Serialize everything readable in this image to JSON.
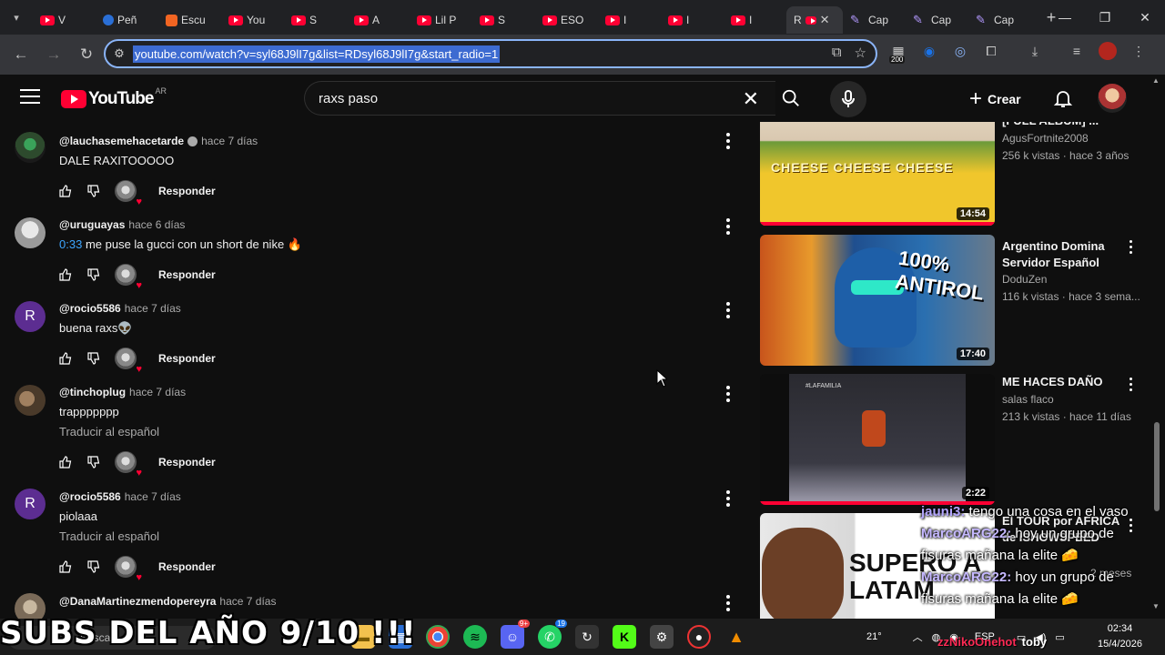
{
  "browser": {
    "tabs": [
      {
        "label": "V",
        "icon": "youtube-icon"
      },
      {
        "label": "Peñ",
        "icon": "gemini-icon"
      },
      {
        "label": "Escu",
        "icon": "soundcloud-icon"
      },
      {
        "label": "You",
        "icon": "youtube-icon"
      },
      {
        "label": "S",
        "icon": "youtube-icon"
      },
      {
        "label": "A",
        "icon": "youtube-icon"
      },
      {
        "label": "Lil P",
        "icon": "youtube-icon"
      },
      {
        "label": "S",
        "icon": "youtube-icon"
      },
      {
        "label": "ESO",
        "icon": "youtube-icon"
      },
      {
        "label": "I",
        "icon": "youtube-icon"
      },
      {
        "label": "I",
        "icon": "youtube-icon"
      },
      {
        "label": "I",
        "icon": "youtube-icon"
      },
      {
        "label": "R",
        "icon": "youtube-icon",
        "active": true
      },
      {
        "label": "Cap",
        "icon": "capcut-icon"
      },
      {
        "label": "Cap",
        "icon": "capcut-icon"
      },
      {
        "label": "Cap",
        "icon": "capcut-icon"
      }
    ],
    "url": "youtube.com/watch?v=syl68J9lI7g&list=RDsyl68J9lI7g&start_radio=1",
    "extension_badge": "200"
  },
  "youtube": {
    "logo_text": "YouTube",
    "country": "AR",
    "search_value": "raxs paso",
    "create_label": "Crear"
  },
  "comments": [
    {
      "handle": "@lauchasemehacetarde",
      "verified": true,
      "time": "hace 7 días",
      "text": "DALE RAXITOOOOO",
      "timestamp": "",
      "translate": "",
      "reply": "Responder",
      "avatar_color": "#2d4a2d"
    },
    {
      "handle": "@uruguayas",
      "verified": false,
      "time": "hace 6 días",
      "text": "me puse la gucci con un short de nike 🔥",
      "timestamp": "0:33",
      "translate": "",
      "reply": "Responder",
      "avatar_color": "#b0b0b0"
    },
    {
      "handle": "@rocio5586",
      "verified": false,
      "time": "hace 7 días",
      "text": "buena raxs👽",
      "timestamp": "",
      "translate": "",
      "reply": "Responder",
      "avatar_letter": "R",
      "avatar_color": "#5c2d91"
    },
    {
      "handle": "@tinchoplug",
      "verified": false,
      "time": "hace 7 días",
      "text": "trappppppp",
      "timestamp": "",
      "translate": "Traducir al español",
      "reply": "Responder",
      "avatar_color": "#6b5a48"
    },
    {
      "handle": "@rocio5586",
      "verified": false,
      "time": "hace 7 días",
      "text": "piolaaa",
      "timestamp": "",
      "translate": "Traducir al español",
      "reply": "Responder",
      "avatar_letter": "R",
      "avatar_color": "#5c2d91"
    },
    {
      "handle": "@DanaMartinezmendopereyra",
      "verified": false,
      "time": "hace 7 días",
      "text": "",
      "timestamp": "",
      "translate": "",
      "reply": "",
      "avatar_color": "#8a8070"
    }
  ],
  "recommendations": [
    {
      "title": "[FULL ALBUM] ...",
      "channel": "AgusFortnite2008",
      "meta": "256 k vistas · hace 3 años",
      "duration": "14:54",
      "thumb_text": "CHEESE CHEESE CHEESE"
    },
    {
      "title": "Argentino Domina Servidor Español",
      "channel": "DoduZen",
      "meta": "116 k vistas · hace 3 sema...",
      "duration": "17:40",
      "thumb_text": "100% ANTIROL"
    },
    {
      "title": "ME HACES DAÑO",
      "channel": "salas flaco",
      "meta": "213 k vistas · hace 11 días",
      "duration": "2:22",
      "thumb_text": "#LAFAMILIA"
    },
    {
      "title": "El TOUR por AFRICA de ISHOWSPEED",
      "channel": "",
      "meta": "2 meses",
      "duration": "",
      "thumb_text": "SUPERO A LATAM"
    }
  ],
  "stream_chat": [
    {
      "user": "jauni3:",
      "text": "tengo una cosa en el vaso"
    },
    {
      "user": "MarcoARG22:",
      "text": "hoy un grupo de fisuras mañana la elite 🧀"
    },
    {
      "user": "MarcoARG22:",
      "text": "hoy un grupo de fisuras mañana la elite 🧀"
    }
  ],
  "overlay": {
    "caption": "SUBS DEL AÑO 9/10 !!!",
    "watermark": "zzNikoOnehot",
    "watermark_name": "toby"
  },
  "taskbar": {
    "search_label": "Buscar",
    "temperature": "21°",
    "language": "ESP",
    "time": "02:34",
    "date": "15/4/2026",
    "whatsapp_badge": "19",
    "discord_badge": "9+"
  }
}
